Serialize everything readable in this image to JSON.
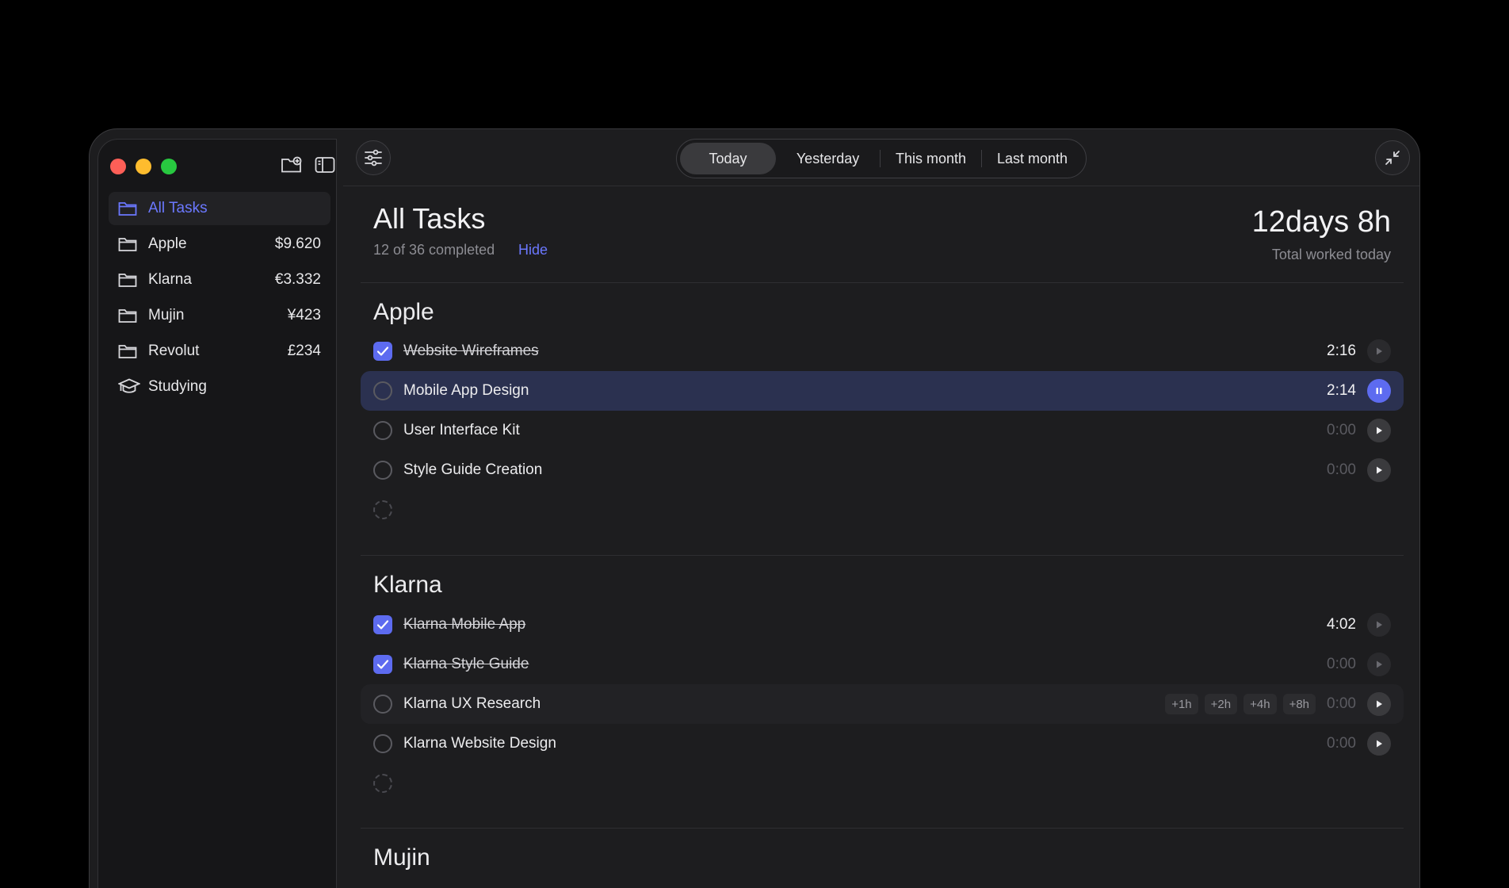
{
  "sidebar": {
    "items": [
      {
        "label": "All Tasks",
        "amount": ""
      },
      {
        "label": "Apple",
        "amount": "$9.620"
      },
      {
        "label": "Klarna",
        "amount": "€3.332"
      },
      {
        "label": "Mujin",
        "amount": "¥423"
      },
      {
        "label": "Revolut",
        "amount": "£234"
      },
      {
        "label": "Studying",
        "amount": ""
      }
    ]
  },
  "toolbar": {
    "tabs": [
      "Today",
      "Yesterday",
      "This month",
      "Last month"
    ]
  },
  "header": {
    "title": "All Tasks",
    "subtitle": "12 of 36 completed",
    "hide": "Hide",
    "total_value": "12days 8h",
    "total_label": "Total worked today"
  },
  "sections": [
    {
      "title": "Apple",
      "tasks": [
        {
          "name": "Website Wireframes",
          "time": "2:16"
        },
        {
          "name": "Mobile App Design",
          "time": "2:14"
        },
        {
          "name": "User Interface Kit",
          "time": "0:00"
        },
        {
          "name": "Style Guide Creation",
          "time": "0:00"
        }
      ]
    },
    {
      "title": "Klarna",
      "tasks": [
        {
          "name": "Klarna Mobile App",
          "time": "4:02"
        },
        {
          "name": "Klarna Style Guide",
          "time": "0:00"
        },
        {
          "name": "Klarna UX Research",
          "time": "0:00"
        },
        {
          "name": "Klarna Website Design",
          "time": "0:00"
        }
      ],
      "quick_add": [
        "+1h",
        "+2h",
        "+4h",
        "+8h"
      ]
    },
    {
      "title": "Mujin"
    }
  ],
  "colors": {
    "accent": "#5d6bf0",
    "running_row": "#2b3150",
    "background": "#1d1d1f",
    "sidebar": "#161618"
  }
}
